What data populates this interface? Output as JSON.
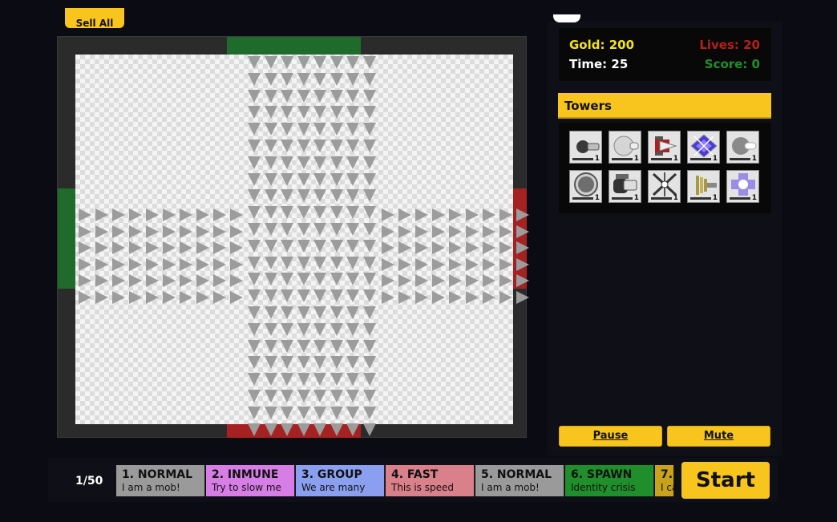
{
  "top_button_label": "Sell All",
  "stats": {
    "gold_label": "Gold: 200",
    "lives_label": "Lives: 20",
    "time_label": "Time: 25",
    "score_label": "Score: 0"
  },
  "towers": {
    "title": "Towers",
    "items": [
      {
        "icon": "cannon-tower-icon",
        "level": "1"
      },
      {
        "icon": "orb-cannon-tower-icon",
        "level": "1"
      },
      {
        "icon": "rocket-tower-icon",
        "level": "1"
      },
      {
        "icon": "crystal-tower-icon",
        "level": "1"
      },
      {
        "icon": "laser-cannon-tower-icon",
        "level": "1"
      },
      {
        "icon": "sphere-tower-icon",
        "level": "1"
      },
      {
        "icon": "heavy-cannon-tower-icon",
        "level": "1"
      },
      {
        "icon": "multi-arrow-tower-icon",
        "level": "1"
      },
      {
        "icon": "tesla-coil-tower-icon",
        "level": "1"
      },
      {
        "icon": "light-cross-tower-icon",
        "level": "1"
      }
    ]
  },
  "controls": {
    "pause_label": "Pause",
    "mute_label": "Mute",
    "start_label": "Start"
  },
  "wave_counter": "1/50",
  "waves": [
    {
      "title": "1. NORMAL",
      "subtitle": "I am a mob!",
      "color": "#9a9a9a"
    },
    {
      "title": "2. INMUNE",
      "subtitle": "Try to slow me",
      "color": "#d77ee6"
    },
    {
      "title": "3. GROUP",
      "subtitle": "We are many",
      "color": "#8b9ff0"
    },
    {
      "title": "4. FAST",
      "subtitle": "This is speed",
      "color": "#d9808a"
    },
    {
      "title": "5. NORMAL",
      "subtitle": "I am a mob!",
      "color": "#9a9a9a"
    },
    {
      "title": "6. SPAWN",
      "subtitle": "Identity crisis",
      "color": "#1f8f2c"
    },
    {
      "title": "7.",
      "subtitle": "I ca",
      "color": "#c9a21a"
    }
  ]
}
